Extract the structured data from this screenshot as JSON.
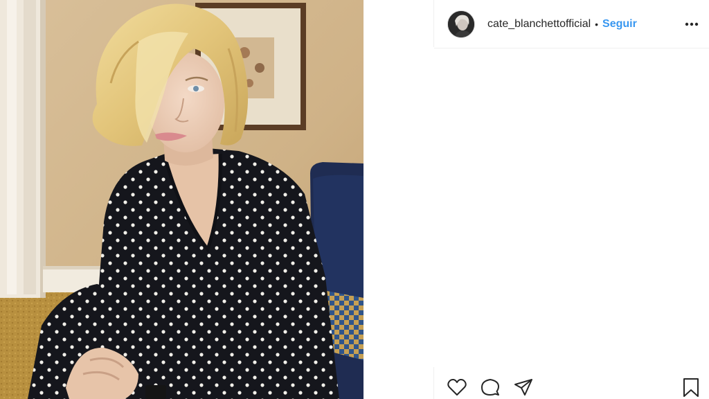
{
  "post": {
    "username": "cate_blanchettofficial",
    "separator": "•",
    "follow_label": "Seguir"
  },
  "icons": {
    "more": "more-options-icon",
    "like": "heart-icon",
    "comment": "comment-icon",
    "share": "paper-plane-icon",
    "save": "bookmark-icon"
  },
  "colors": {
    "follow": "#3897f0",
    "text": "#262626",
    "divider": "#efefef"
  }
}
